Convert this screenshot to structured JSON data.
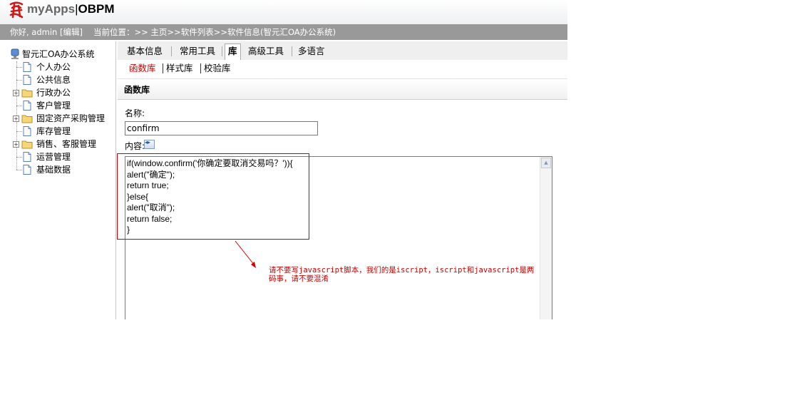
{
  "header": {
    "brand_name": "myApps",
    "brand_separator": "|",
    "product": "OBPM",
    "logo_icon": "red-calligraphy-logo"
  },
  "status": {
    "greeting": "你好, admin [编辑]",
    "breadcrumb": "当前位置：>> 主页>>软件列表>>软件信息(智元汇OA办公系统)"
  },
  "sidebar": {
    "root_label": "智元汇OA办公系统",
    "items": [
      {
        "label": "个人办公",
        "type": "page",
        "expandable": false
      },
      {
        "label": "公共信息",
        "type": "page",
        "expandable": false
      },
      {
        "label": "行政办公",
        "type": "folder",
        "expandable": true
      },
      {
        "label": "客户管理",
        "type": "page",
        "expandable": false
      },
      {
        "label": "固定资产采购管理",
        "type": "folder",
        "expandable": true
      },
      {
        "label": "库存管理",
        "type": "page",
        "expandable": false
      },
      {
        "label": "销售、客服管理",
        "type": "folder",
        "expandable": true
      },
      {
        "label": "运营管理",
        "type": "page",
        "expandable": false
      },
      {
        "label": "基础数据",
        "type": "page",
        "expandable": false
      }
    ]
  },
  "tabs": [
    {
      "label": "基本信息",
      "active": false
    },
    {
      "label": "常用工具",
      "active": false
    },
    {
      "label": "库",
      "active": true
    },
    {
      "label": "高级工具",
      "active": false
    },
    {
      "label": "多语言",
      "active": false
    }
  ],
  "subtabs": [
    {
      "label": "函数库",
      "active": true
    },
    {
      "label": "样式库",
      "active": false
    },
    {
      "label": "校验库",
      "active": false
    }
  ],
  "section_title": "函数库",
  "form": {
    "name_label": "名称:",
    "name_value": "confirm",
    "content_label": "内容:",
    "code": "if(window.confirm('你确定要取消交易吗？')){\nalert(\"确定\");\nreturn true;\n}else{\nalert(\"取消\");\nreturn false;\n}"
  },
  "annotation": {
    "text": "请不要写javascript脚本，我们的是iscript，iscript和javascript是两码事，请不要混淆",
    "color": "#cc0000"
  },
  "colors": {
    "status_bar": "#999999",
    "active_subtab": "#cc0000"
  }
}
